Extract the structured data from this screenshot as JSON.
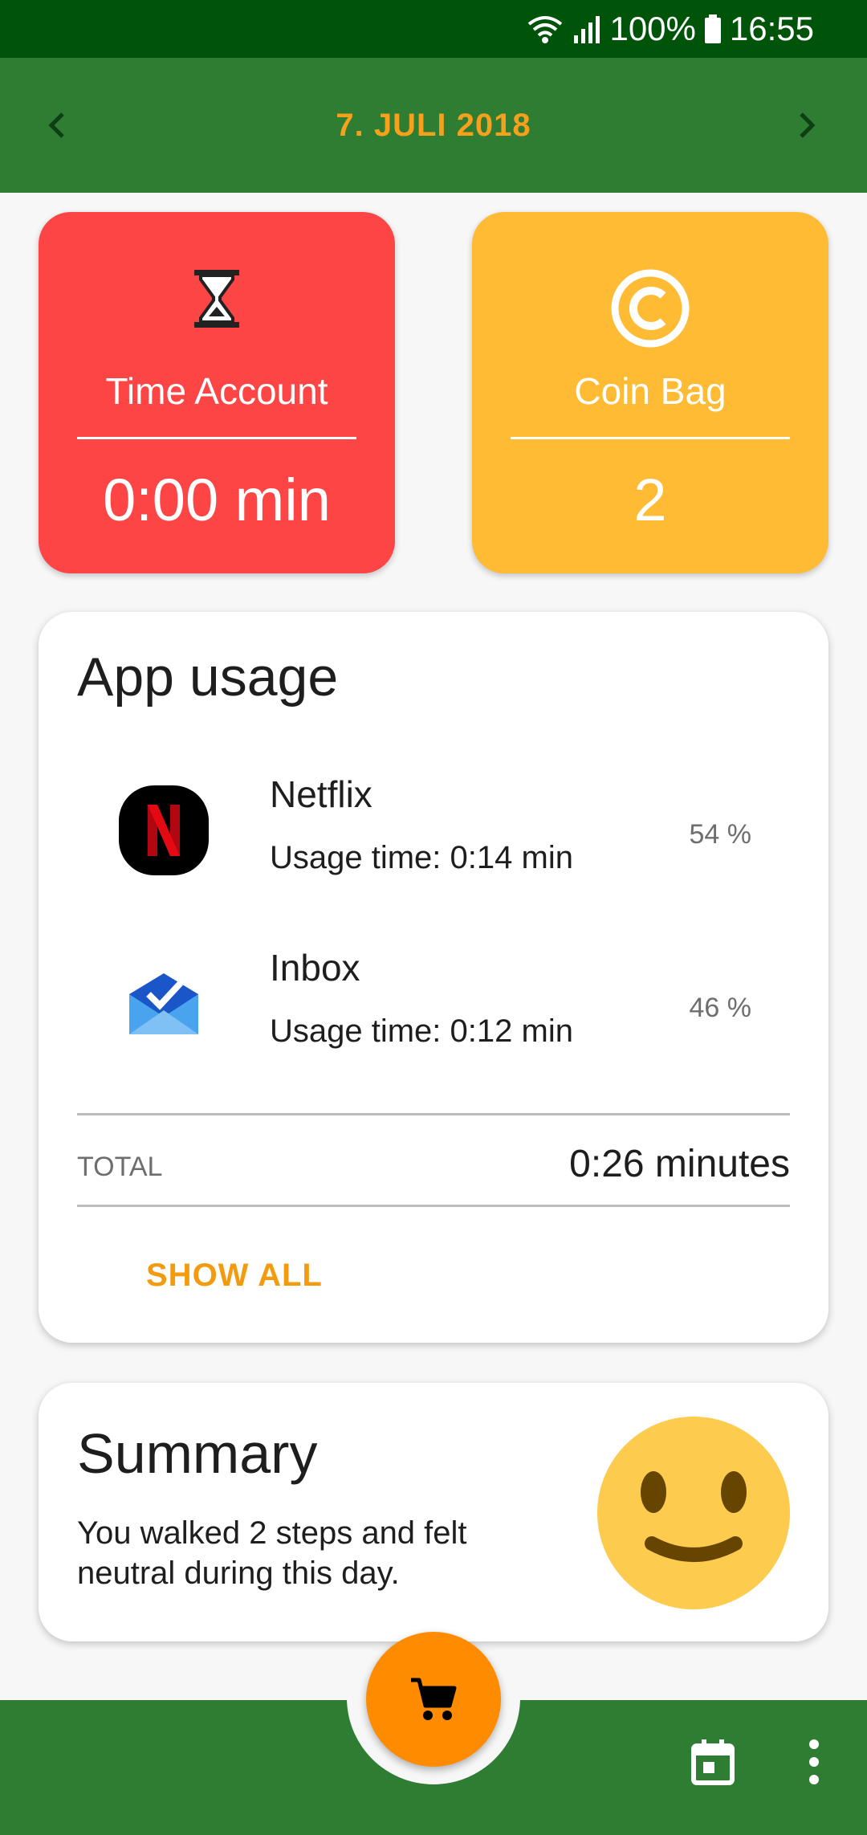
{
  "status_bar": {
    "battery": "100%",
    "time": "16:55",
    "icons": [
      "wifi-icon",
      "signal-icon",
      "battery-icon"
    ]
  },
  "app_bar": {
    "date": "7. JULI 2018",
    "prev_icon": "chevron-left-icon",
    "next_icon": "chevron-right-icon"
  },
  "tiles": {
    "time_account": {
      "label": "Time Account",
      "value": "0:00 min",
      "icon": "hourglass-icon",
      "color": "#fd4545"
    },
    "coin_bag": {
      "label": "Coin Bag",
      "value": "2",
      "icon": "copyright-coin-icon",
      "color": "#ffbb33"
    }
  },
  "usage": {
    "title": "App usage",
    "apps": [
      {
        "name": "Netflix",
        "time": "Usage time: 0:14 min",
        "percent": "54 %",
        "icon": "netflix-icon"
      },
      {
        "name": "Inbox",
        "time": "Usage time: 0:12 min",
        "percent": "46 %",
        "icon": "inbox-icon"
      }
    ],
    "total_label": "TOTAL",
    "total_value": "0:26 minutes",
    "show_all": "SHOW ALL"
  },
  "summary": {
    "title": "Summary",
    "text": "You walked 2 steps and felt neutral during this day.",
    "mood_icon": "smiley-face-icon"
  },
  "bottom_bar": {
    "fab_icon": "shopping-cart-icon",
    "actions": [
      "calendar-icon",
      "more-vertical-icon"
    ]
  },
  "colors": {
    "status_bar": "#00540a",
    "primary": "#2f7d32",
    "accent": "#f39b0e",
    "fab": "#ff8c00"
  }
}
